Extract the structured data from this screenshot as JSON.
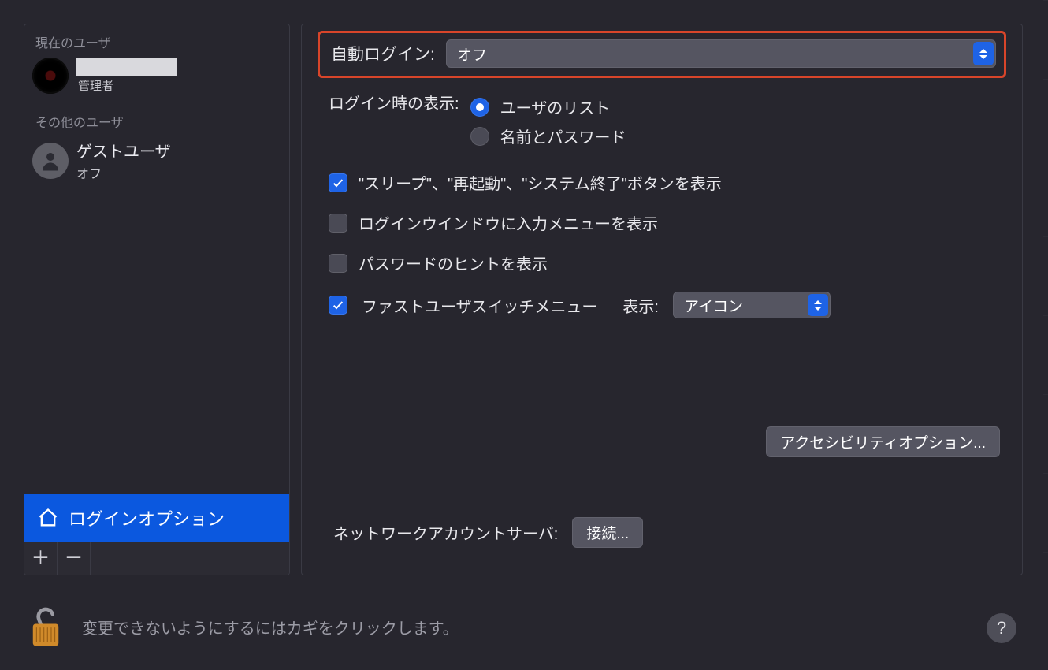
{
  "sidebar": {
    "current_user_header": "現在のユーザ",
    "current_user": {
      "role": "管理者"
    },
    "other_users_header": "その他のユーザ",
    "guest": {
      "name": "ゲストユーザ",
      "status": "オフ"
    },
    "login_options_label": "ログインオプション"
  },
  "main": {
    "auto_login": {
      "label": "自動ログイン:",
      "value": "オフ"
    },
    "login_display": {
      "label": "ログイン時の表示:",
      "option_list": "ユーザのリスト",
      "option_namepw": "名前とパスワード"
    },
    "checks": {
      "sleep_restart_shutdown": "\"スリープ\"、\"再起動\"、\"システム終了\"ボタンを表示",
      "input_menu": "ログインウインドウに入力メニューを表示",
      "password_hints": "パスワードのヒントを表示",
      "fast_user_switch": "ファストユーザスイッチメニュー",
      "fast_user_display_label": "表示:",
      "fast_user_display_value": "アイコン"
    },
    "accessibility_button": "アクセシビリティオプション...",
    "network_account": {
      "label": "ネットワークアカウントサーバ:",
      "button": "接続..."
    }
  },
  "lock_bar": {
    "text": "変更できないようにするにはカギをクリックします。"
  },
  "help_button": "?"
}
